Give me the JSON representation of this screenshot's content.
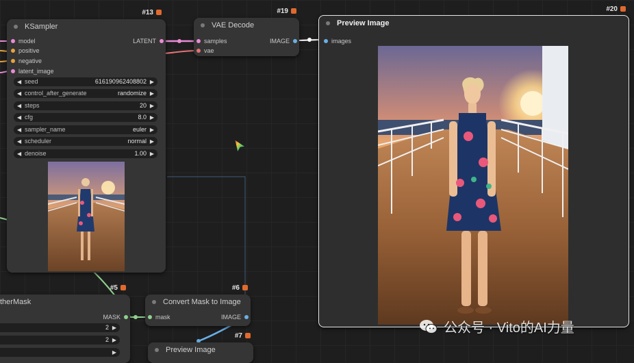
{
  "ksampler": {
    "id": "#13",
    "title": "KSampler",
    "inputs": [
      "model",
      "positive",
      "negative",
      "latent_image"
    ],
    "output": "LATENT",
    "widgets": [
      {
        "label": "seed",
        "value": "616190962408802"
      },
      {
        "label": "control_after_generate",
        "value": "randomize"
      },
      {
        "label": "steps",
        "value": "20"
      },
      {
        "label": "cfg",
        "value": "8.0"
      },
      {
        "label": "sampler_name",
        "value": "euler"
      },
      {
        "label": "scheduler",
        "value": "normal"
      },
      {
        "label": "denoise",
        "value": "1.00"
      }
    ]
  },
  "vae_decode": {
    "id": "#19",
    "title": "VAE Decode",
    "inputs": [
      "samples",
      "vae"
    ],
    "output": "IMAGE"
  },
  "preview_main": {
    "id": "#20",
    "title": "Preview Image",
    "input": "images"
  },
  "feather_mask": {
    "id": "#5",
    "title": "therMask",
    "output": "MASK",
    "values": [
      "2",
      "2"
    ]
  },
  "convert_mask": {
    "id": "#6",
    "title": "Convert Mask to Image",
    "input": "mask",
    "output": "IMAGE"
  },
  "preview_small": {
    "id": "#7",
    "title": "Preview Image"
  },
  "watermark": {
    "text": "公众号 · Vito的AI力量"
  },
  "colors": {
    "canvas": "#1e1e1e",
    "node": "#353535",
    "latent_wire": "#e98bd5",
    "image_wire": "#6ab0e6",
    "mask_wire": "#8fd08f",
    "vae_wire": "#e57373"
  }
}
